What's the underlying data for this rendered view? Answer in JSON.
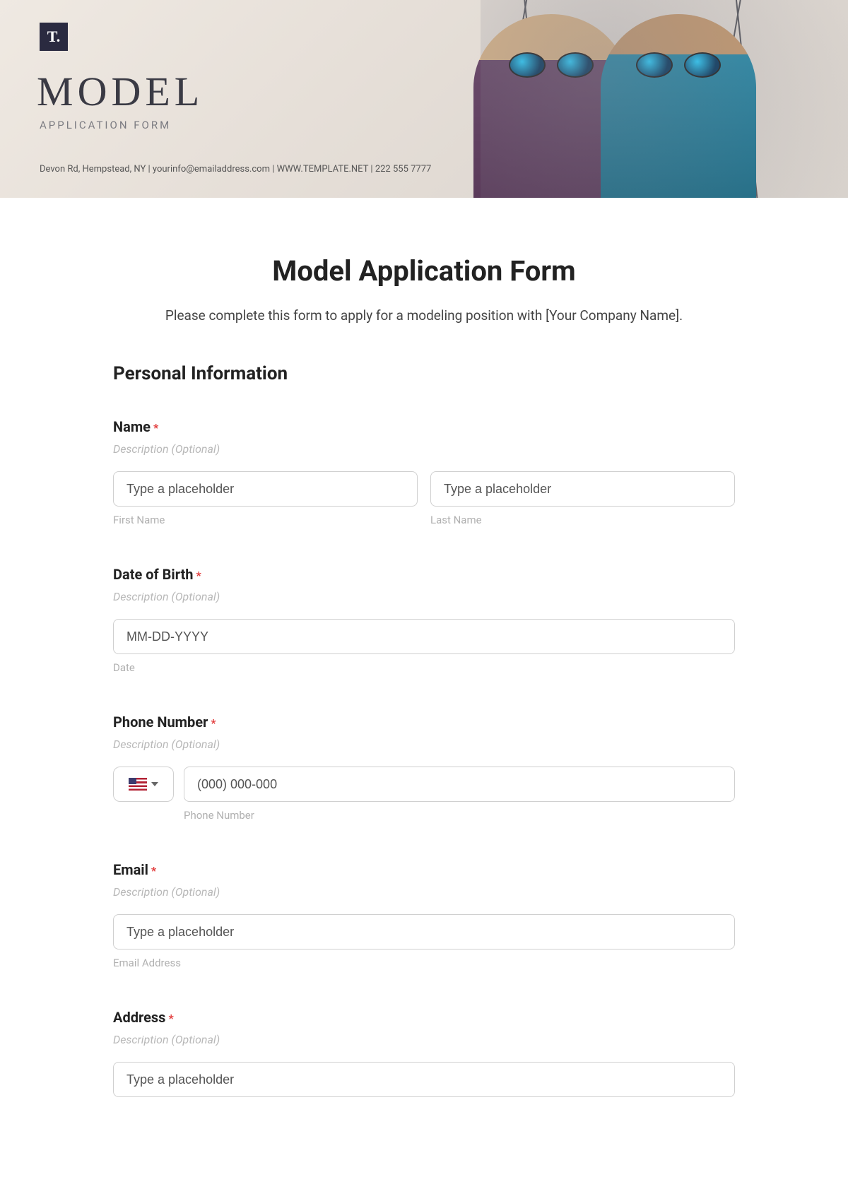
{
  "banner": {
    "logo_text": "T.",
    "title": "MODEL",
    "subtitle": "APPLICATION FORM",
    "contact_line": "Devon Rd, Hempstead, NY | yourinfo@emailaddress.com | WWW.TEMPLATE.NET | 222 555 7777"
  },
  "form": {
    "title": "Model Application Form",
    "intro": "Please complete this form to apply for a modeling position with [Your Company Name].",
    "section_personal": "Personal Information",
    "description_placeholder": "Description (Optional)",
    "required_marker": "*",
    "fields": {
      "name": {
        "label": "Name",
        "first_placeholder": "Type a placeholder",
        "last_placeholder": "Type a placeholder",
        "first_sub": "First Name",
        "last_sub": "Last Name"
      },
      "dob": {
        "label": "Date of Birth",
        "placeholder": "MM-DD-YYYY",
        "sub": "Date"
      },
      "phone": {
        "label": "Phone Number",
        "placeholder": "(000) 000-000",
        "sub": "Phone Number"
      },
      "email": {
        "label": "Email",
        "placeholder": "Type a placeholder",
        "sub": "Email Address"
      },
      "address": {
        "label": "Address",
        "placeholder": "Type a placeholder"
      }
    }
  }
}
